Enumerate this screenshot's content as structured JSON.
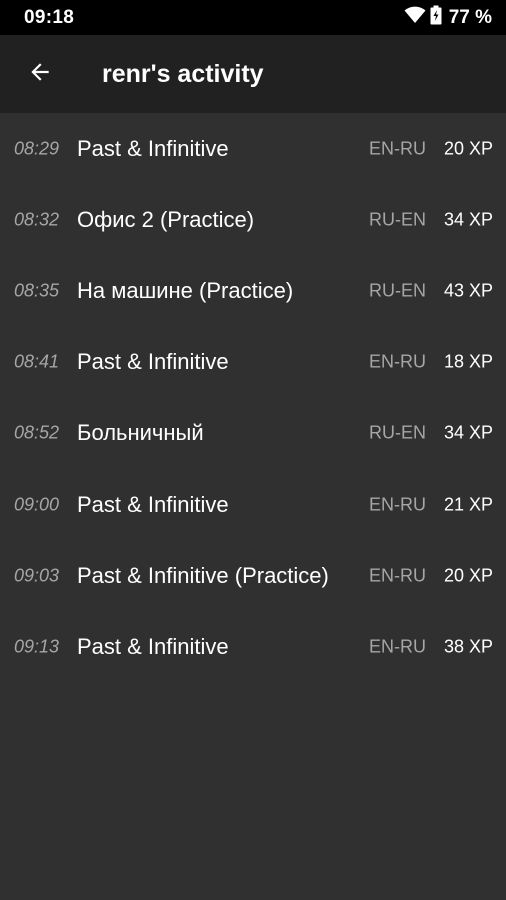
{
  "status_bar": {
    "time": "09:18",
    "battery": "77 %",
    "icons": [
      "wifi-icon",
      "battery-icon"
    ]
  },
  "app_bar": {
    "title": "renr's activity",
    "back_icon": "arrow-back-icon"
  },
  "activities": [
    {
      "time": "08:29",
      "title": "Past & Infinitive",
      "lang": "EN-RU",
      "xp": "20 XP"
    },
    {
      "time": "08:32",
      "title": "Офис 2 (Practice)",
      "lang": "RU-EN",
      "xp": "34 XP"
    },
    {
      "time": "08:35",
      "title": "На машине (Practice)",
      "lang": "RU-EN",
      "xp": "43 XP"
    },
    {
      "time": "08:41",
      "title": "Past & Infinitive",
      "lang": "EN-RU",
      "xp": "18 XP"
    },
    {
      "time": "08:52",
      "title": "Больничный",
      "lang": "RU-EN",
      "xp": "34 XP"
    },
    {
      "time": "09:00",
      "title": "Past & Infinitive",
      "lang": "EN-RU",
      "xp": "21 XP"
    },
    {
      "time": "09:03",
      "title": "Past & Infinitive (Practice)",
      "lang": "EN-RU",
      "xp": "20 XP"
    },
    {
      "time": "09:13",
      "title": "Past & Infinitive",
      "lang": "EN-RU",
      "xp": "38 XP"
    }
  ],
  "colors": {
    "background": "#303030",
    "app_bar": "#212121",
    "status_bar": "#000000",
    "secondary_text": "#a6a6a6",
    "primary_text": "#ffffff"
  }
}
